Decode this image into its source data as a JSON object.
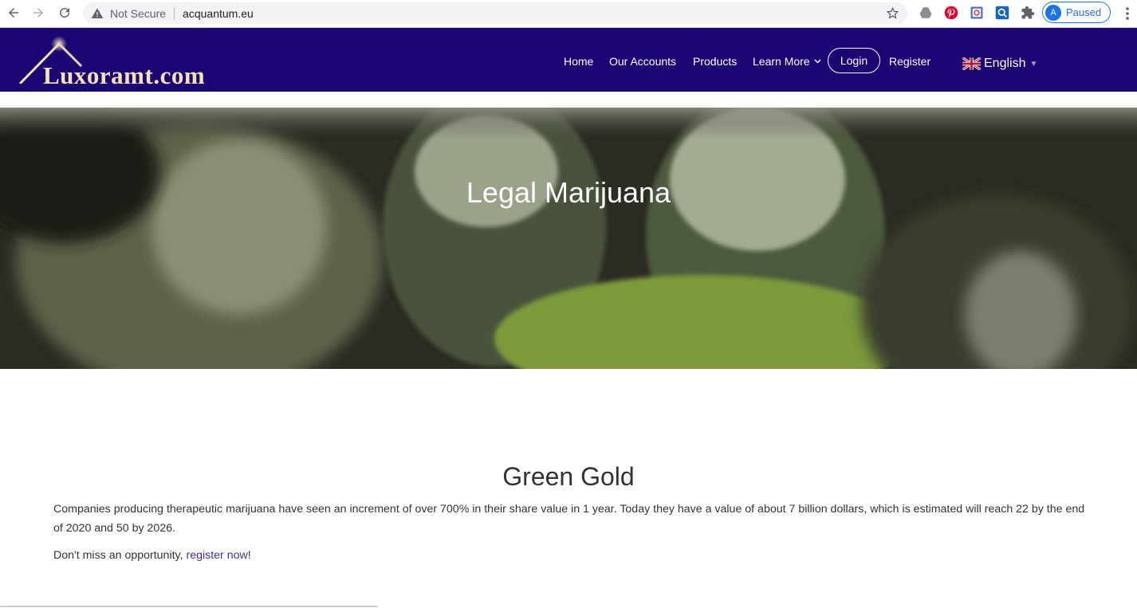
{
  "browser": {
    "security_label": "Not Secure",
    "url": "acquantum.eu",
    "profile_initial": "A",
    "profile_status": "Paused",
    "extensions": [
      "drive-icon",
      "pinterest-icon",
      "extension-icon",
      "search-extension-icon",
      "puzzle-icon"
    ]
  },
  "site": {
    "logo_text": "Luxoramt.com",
    "nav": {
      "home": "Home",
      "accounts": "Our Accounts",
      "products": "Products",
      "learn_more": "Learn More",
      "login": "Login",
      "register": "Register",
      "language": "English"
    },
    "colors": {
      "header_bg": "#1b0575",
      "link": "#4a2b97"
    }
  },
  "hero": {
    "title": "Legal Marijuana"
  },
  "content": {
    "title": "Green Gold",
    "paragraph": "Companies producing therapeutic marijuana have seen an increment of over 700% in their share value in 1 year. Today they have a value of about 7 billion dollars, which is estimated will reach 22 by the end of 2020 and 50 by 2026.",
    "cta_prefix": "Don't miss an opportunity, ",
    "cta_link": "register now",
    "cta_suffix": "!"
  }
}
